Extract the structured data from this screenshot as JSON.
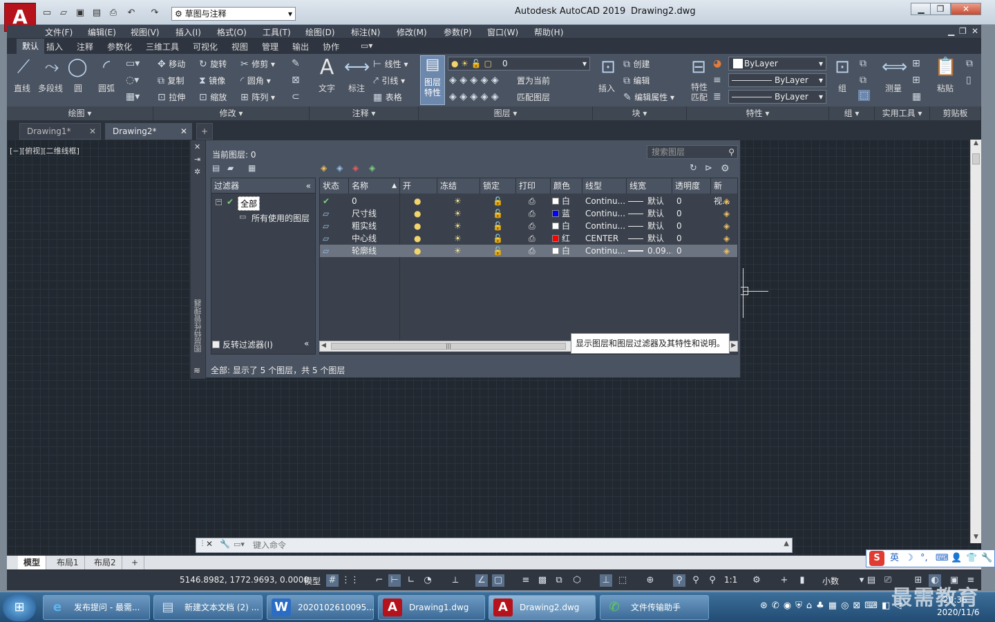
{
  "window": {
    "app_title": "Autodesk AutoCAD 2019",
    "doc_title": "Drawing2.dwg",
    "logo": "A",
    "workspace": "草图与注释"
  },
  "menu": [
    "文件(F)",
    "编辑(E)",
    "视图(V)",
    "插入(I)",
    "格式(O)",
    "工具(T)",
    "绘图(D)",
    "标注(N)",
    "修改(M)",
    "参数(P)",
    "窗口(W)",
    "帮助(H)"
  ],
  "ribbon_tabs": [
    "默认",
    "插入",
    "注释",
    "参数化",
    "三维工具",
    "可视化",
    "视图",
    "管理",
    "输出",
    "协作"
  ],
  "ribbon": {
    "draw": {
      "line": "直线",
      "polyline": "多段线",
      "circle": "圆",
      "arc": "圆弧",
      "panel": "绘图"
    },
    "modify": {
      "move": "移动",
      "rotate": "旋转",
      "trim": "修剪",
      "copy": "复制",
      "mirror": "镜像",
      "fillet": "圆角",
      "stretch": "拉伸",
      "scale": "缩放",
      "array": "阵列",
      "panel": "修改"
    },
    "annotation": {
      "text": "文字",
      "dim": "标注",
      "linear": "线性",
      "leader": "引线",
      "table": "表格",
      "panel": "注释"
    },
    "layers": {
      "props": "图层特性",
      "current_layer": "0",
      "set_current": "置为当前",
      "match": "匹配图层",
      "panel": "图层"
    },
    "block": {
      "insert": "插入",
      "create": "创建",
      "edit": "编辑",
      "edit_attr": "编辑属性",
      "panel": "块"
    },
    "properties": {
      "match": "特性匹配",
      "color": "ByLayer",
      "linetype": "ByLayer",
      "lineweight": "ByLayer",
      "panel": "特性"
    },
    "groups": {
      "group": "组",
      "panel": "组"
    },
    "utilities": {
      "measure": "测量",
      "panel": "实用工具"
    },
    "clipboard": {
      "paste": "粘贴",
      "panel": "剪贴板"
    }
  },
  "file_tabs": [
    "Drawing1*",
    "Drawing2*"
  ],
  "view_label": "[−][俯视][二维线框]",
  "layer_manager": {
    "vertical_title": "图层特性管理器",
    "current_layer": "当前图层: 0",
    "search_placeholder": "搜索图层",
    "filter_header": "过滤器",
    "tree_all": "全部",
    "tree_used": "所有使用的图层",
    "invert_filter": "反转过滤器(I)",
    "columns": [
      "状态",
      "名称",
      "开",
      "冻结",
      "锁定",
      "打印",
      "颜色",
      "线型",
      "线宽",
      "透明度",
      "新视..."
    ],
    "layers": [
      {
        "name": "0",
        "color": "白",
        "hex": "#ffffff",
        "linetype": "Continu...",
        "lineweight": "默认",
        "transparency": "0"
      },
      {
        "name": "尺寸线",
        "color": "蓝",
        "hex": "#0000ff",
        "linetype": "Continu...",
        "lineweight": "默认",
        "transparency": "0"
      },
      {
        "name": "粗实线",
        "color": "白",
        "hex": "#ffffff",
        "linetype": "Continu...",
        "lineweight": "默认",
        "transparency": "0"
      },
      {
        "name": "中心线",
        "color": "红",
        "hex": "#ff0000",
        "linetype": "CENTER",
        "lineweight": "默认",
        "transparency": "0"
      },
      {
        "name": "轮廓线",
        "color": "白",
        "hex": "#ffffff",
        "linetype": "Continu...",
        "lineweight": "0.09...",
        "transparency": "0"
      }
    ],
    "tooltip": "显示图层和图层过滤器及其特性和说明。",
    "status": "全部: 显示了 5 个图层，共 5 个图层"
  },
  "command": {
    "placeholder": "键入命令"
  },
  "layout_tabs": [
    "模型",
    "布局1",
    "布局2"
  ],
  "statusbar": {
    "coords": "5146.8982, 1772.9693, 0.0000",
    "model": "模型",
    "scale": "1:1",
    "units": "小数"
  },
  "ime": {
    "label": "英"
  },
  "taskbar": {
    "items": [
      {
        "label": "发布提问 - 最需...",
        "icon": "e"
      },
      {
        "label": "新建文本文档 (2) ...",
        "icon": "▤"
      },
      {
        "label": "2020102610095...",
        "icon": "W"
      },
      {
        "label": "Drawing1.dwg",
        "icon": "A"
      },
      {
        "label": "Drawing2.dwg",
        "icon": "A"
      },
      {
        "label": "文件传输助手",
        "icon": "✆"
      }
    ],
    "time": "20:36",
    "date": "2020/11/6"
  },
  "watermark": "最需教育"
}
